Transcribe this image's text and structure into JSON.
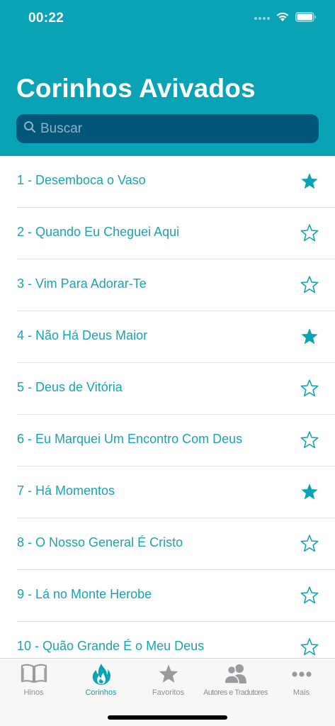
{
  "status": {
    "time": "00:22"
  },
  "header": {
    "title": "Corinhos Avivados"
  },
  "search": {
    "placeholder": "Buscar",
    "value": ""
  },
  "list": {
    "items": [
      {
        "label": "1 - Desemboca o Vaso",
        "favorite": true
      },
      {
        "label": "2 - Quando Eu Cheguei Aqui",
        "favorite": false
      },
      {
        "label": "3 - Vim Para Adorar-Te",
        "favorite": false
      },
      {
        "label": "4 - Não Há Deus Maior",
        "favorite": true
      },
      {
        "label": "5 - Deus de Vitória",
        "favorite": false
      },
      {
        "label": "6 - Eu Marquei Um Encontro Com Deus",
        "favorite": false
      },
      {
        "label": "7 - Há Momentos",
        "favorite": true
      },
      {
        "label": "8 - O Nosso General É Cristo",
        "favorite": false
      },
      {
        "label": "9 - Lá no Monte Herobe",
        "favorite": false
      },
      {
        "label": "10 - Quão Grande É o Meu Deus",
        "favorite": false
      }
    ]
  },
  "tabbar": {
    "tabs": [
      {
        "label": "Hinos",
        "icon": "book-icon",
        "active": false
      },
      {
        "label": "Corinhos",
        "icon": "flame-icon",
        "active": true
      },
      {
        "label": "Favoritos",
        "icon": "star-icon",
        "active": false
      },
      {
        "label": "Autores e Tradutores",
        "icon": "people-icon",
        "active": false
      },
      {
        "label": "Mais",
        "icon": "more-icon",
        "active": false
      }
    ]
  },
  "colors": {
    "accent": "#0aa3b6",
    "search_bg": "#02567a",
    "inactive": "#8e8e93"
  }
}
